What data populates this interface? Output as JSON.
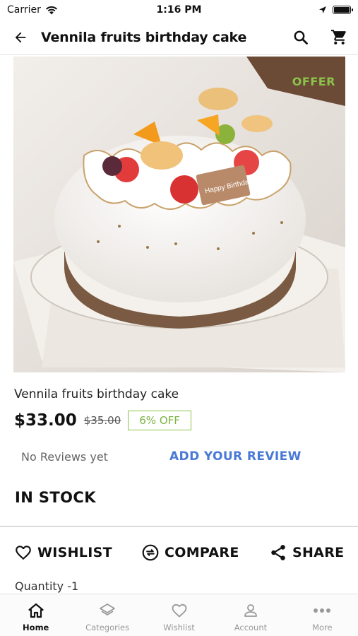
{
  "status_bar": {
    "carrier": "Carrier",
    "time": "1:16 PM"
  },
  "header": {
    "title": "Vennila fruits birthday cake"
  },
  "product": {
    "offer_label": "OFFER",
    "name": "Vennila fruits birthday cake",
    "price": "$33.00",
    "old_price": "$35.00",
    "discount": "6% OFF",
    "reviews_text": "No Reviews yet",
    "add_review_label": "ADD YOUR REVIEW",
    "stock_status": "IN STOCK",
    "quantity": "Quantity -1",
    "image_text": "Happy Birthday"
  },
  "actions": {
    "wishlist": "WISHLIST",
    "compare": "COMPARE",
    "share": "SHARE"
  },
  "tabs": [
    {
      "label": "Home",
      "icon": "home-icon",
      "active": true
    },
    {
      "label": "Categories",
      "icon": "layers-icon",
      "active": false
    },
    {
      "label": "Wishlist",
      "icon": "heart-icon",
      "active": false
    },
    {
      "label": "Account",
      "icon": "person-icon",
      "active": false
    },
    {
      "label": "More",
      "icon": "more-icon",
      "active": false
    }
  ],
  "colors": {
    "offer_green": "#8bc34a",
    "review_blue": "#4a79d6",
    "active_tab": "#111111",
    "inactive_tab": "#999999"
  }
}
